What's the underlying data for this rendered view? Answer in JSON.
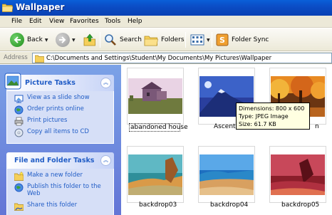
{
  "window": {
    "title": "Wallpaper"
  },
  "menu": [
    "File",
    "Edit",
    "View",
    "Favorites",
    "Tools",
    "Help"
  ],
  "toolbar": {
    "back": "Back",
    "search": "Search",
    "folders": "Folders",
    "folder_sync": "Folder Sync"
  },
  "address": {
    "label": "Address",
    "path": "C:\\Documents and Settings\\Student\\My Documents\\My Pictures\\Wallpaper"
  },
  "picture_tasks": {
    "title": "Picture Tasks",
    "items": [
      "View as a slide show",
      "Order prints online",
      "Print pictures",
      "Copy all items to CD"
    ]
  },
  "file_tasks": {
    "title": "File and Folder Tasks",
    "items": [
      "Make a new folder",
      "Publish this folder to the Web",
      "Share this folder"
    ]
  },
  "files": [
    {
      "name": "abandoned house",
      "selected": true
    },
    {
      "name": "Ascent",
      "selected": false
    },
    {
      "name": "n",
      "selected": false
    },
    {
      "name": "backdrop03",
      "selected": false
    },
    {
      "name": "backdrop04",
      "selected": false
    },
    {
      "name": "backdrop05",
      "selected": false
    }
  ],
  "tooltip": {
    "dimensions": "Dimensions: 800 x 600",
    "type": "Type: JPEG Image",
    "size": "Size: 61.7 KB"
  },
  "colors": {
    "titlebar": "#0b4cc4",
    "taskpane": "#6f8fe0",
    "link": "#215dc6",
    "tooltip_bg": "#ffffe1"
  }
}
